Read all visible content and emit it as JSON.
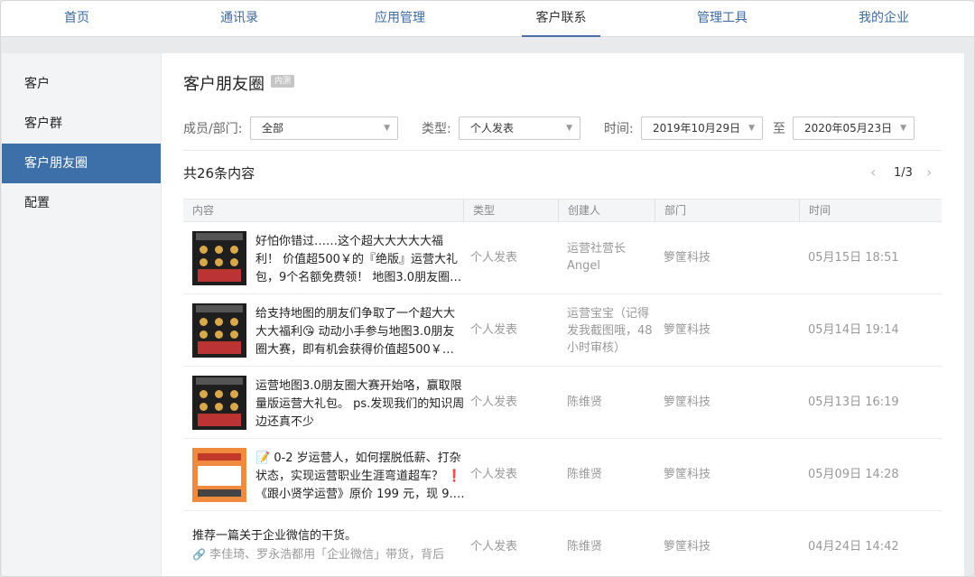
{
  "nav": {
    "tabs": [
      {
        "label": "首页"
      },
      {
        "label": "通讯录"
      },
      {
        "label": "应用管理"
      },
      {
        "label": "客户联系",
        "active": true
      },
      {
        "label": "管理工具"
      },
      {
        "label": "我的企业"
      }
    ]
  },
  "sidebar": {
    "items": [
      {
        "label": "客户"
      },
      {
        "label": "客户群"
      },
      {
        "label": "客户朋友圈",
        "active": true
      },
      {
        "label": "配置"
      }
    ]
  },
  "main": {
    "title": "客户朋友圈",
    "badge": "内测",
    "filters": {
      "member_label": "成员/部门:",
      "member_value": "全部",
      "type_label": "类型:",
      "type_value": "个人发表",
      "time_label": "时间:",
      "date_from": "2019年10月29日",
      "to_label": "至",
      "date_to": "2020年05月23日"
    },
    "total": "共26条内容",
    "pager": {
      "text": "1/3",
      "prev": "‹",
      "next": "›"
    },
    "table": {
      "headers": [
        "内容",
        "类型",
        "创建人",
        "部门",
        "时间"
      ],
      "rows": [
        {
          "thumb": "dark",
          "lines": [
            "好怕你错过……这个超大大大大大福",
            "利！ 价值超500￥的『绝版』运营大礼",
            "包，9个名额免费领！ 地图3.0朋友圈…"
          ],
          "type": "个人发表",
          "creator": [
            "运营社营长",
            "Angel"
          ],
          "dept": "箩筐科技",
          "time": "05月15日 18:51"
        },
        {
          "thumb": "dark",
          "lines": [
            "给支持地图的朋友们争取了一个超大大",
            "大大福利😘 动动小手参与地图3.0朋友",
            "圈大赛，即有机会获得价值超500￥…"
          ],
          "type": "个人发表",
          "creator": [
            "运营宝宝（记得",
            "发我截图哦，48",
            "小时审核）"
          ],
          "dept": "箩筐科技",
          "time": "05月14日 19:14"
        },
        {
          "thumb": "dark",
          "lines": [
            "运营地图3.0朋友圈大赛开始咯，赢取限",
            "量版运营大礼包。 ps.发现我们的知识周",
            "边还真不少"
          ],
          "type": "个人发表",
          "creator": [
            "陈维贤"
          ],
          "dept": "箩筐科技",
          "time": "05月13日 16:19"
        },
        {
          "thumb": "orange",
          "lines": [
            "📝 0-2 岁运营人，如何摆脱低薪、打杂",
            "状态，实现运营职业生涯弯道超车？ ❗",
            "《跟小贤学运营》原价 199 元，现 9.…"
          ],
          "type": "个人发表",
          "creator": [
            "陈维贤"
          ],
          "dept": "箩筐科技",
          "time": "05月09日 14:28"
        },
        {
          "thumb": "none",
          "lines": [
            "推荐一篇关于企业微信的干货。"
          ],
          "sub": "李佳琦、罗永浩都用「企业微信」带货，背后",
          "type": "个人发表",
          "creator": [
            "陈维贤"
          ],
          "dept": "箩筐科技",
          "time": "04月24日 14:42"
        }
      ]
    }
  },
  "icons": {
    "caret": "caret-down-icon",
    "link": "link-icon"
  },
  "colors": {
    "accent": "#3d70a8",
    "nav_link": "#3c6aa0"
  }
}
